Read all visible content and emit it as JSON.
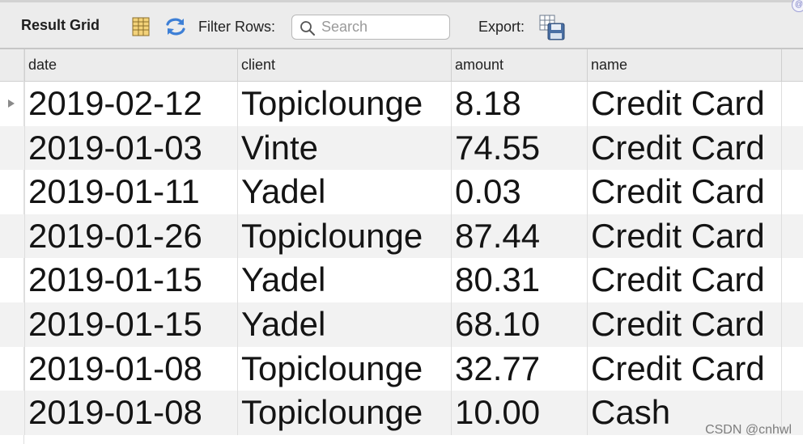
{
  "toolbar": {
    "title": "Result Grid",
    "filter_label": "Filter Rows:",
    "search_placeholder": "Search",
    "search_value": "",
    "export_label": "Export:",
    "icons": [
      "grid-icon",
      "refresh-icon",
      "search-icon",
      "export-icon"
    ]
  },
  "columns": [
    "date",
    "client",
    "amount",
    "name"
  ],
  "rows": [
    {
      "date": "2019-02-12",
      "client": "Topiclounge",
      "amount": "8.18",
      "name": "Credit Card",
      "selected": true
    },
    {
      "date": "2019-01-03",
      "client": "Vinte",
      "amount": "74.55",
      "name": "Credit Card"
    },
    {
      "date": "2019-01-11",
      "client": "Yadel",
      "amount": "0.03",
      "name": "Credit Card"
    },
    {
      "date": "2019-01-26",
      "client": "Topiclounge",
      "amount": "87.44",
      "name": "Credit Card"
    },
    {
      "date": "2019-01-15",
      "client": "Yadel",
      "amount": "80.31",
      "name": "Credit Card"
    },
    {
      "date": "2019-01-15",
      "client": "Yadel",
      "amount": "68.10",
      "name": "Credit Card"
    },
    {
      "date": "2019-01-08",
      "client": "Topiclounge",
      "amount": "32.77",
      "name": "Credit Card"
    },
    {
      "date": "2019-01-08",
      "client": "Topiclounge",
      "amount": "10.00",
      "name": "Cash"
    }
  ],
  "watermark": "CSDN @cnhwl",
  "colors": {
    "toolbar_bg": "#ececec",
    "stripe": "#f2f2f2",
    "refresh_icon": "#3d7fd6"
  }
}
